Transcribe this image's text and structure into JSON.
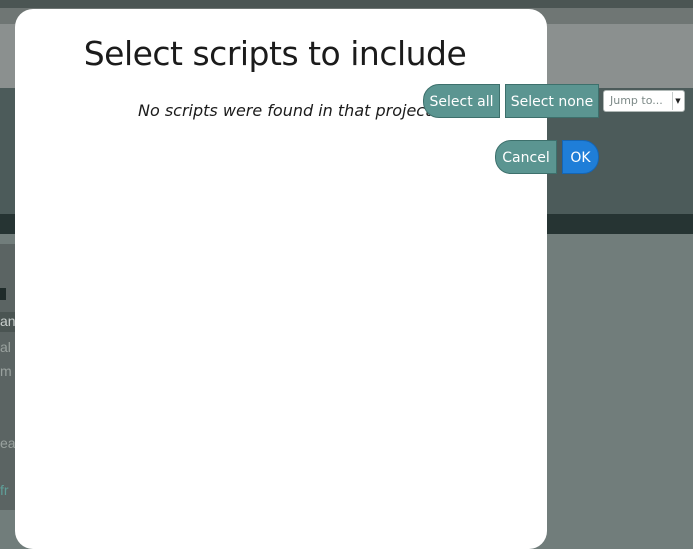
{
  "dialog": {
    "title": "Select scripts to include",
    "empty_message": "No scripts were found in that project file!",
    "select_all_label": "Select all",
    "select_none_label": "Select none",
    "jump_placeholder": "Jump to...",
    "cancel_label": "Cancel",
    "ok_label": "OK"
  },
  "background_fragments": [
    "an",
    "al",
    "m",
    "ea",
    "fr"
  ],
  "colors": {
    "teal_button": "#5b9591",
    "ok_button": "#1f7ed8",
    "overlay": "#717d7b",
    "modal_bg": "#ffffff"
  },
  "icons": {
    "jump_dropdown": "chevron-down-icon"
  }
}
